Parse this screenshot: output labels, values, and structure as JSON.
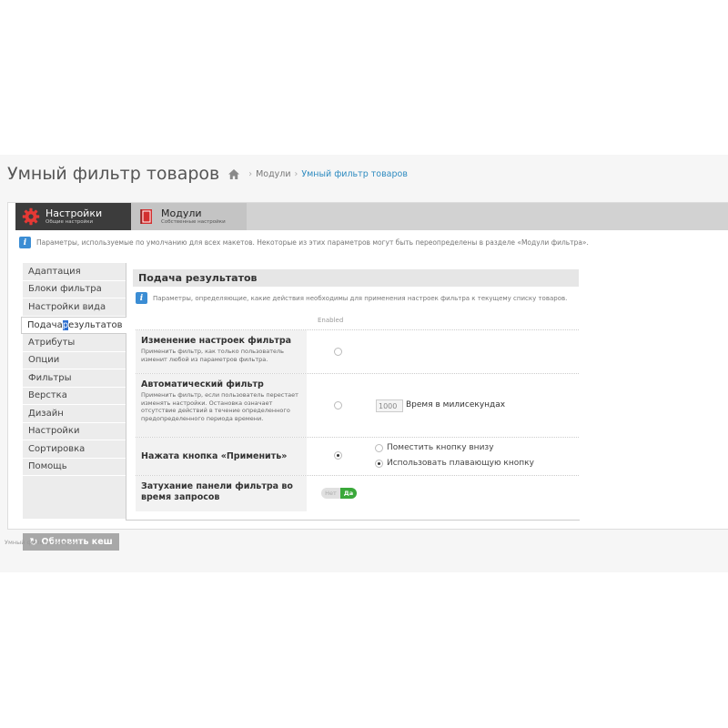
{
  "header": {
    "title": "Умный фильтр товаров",
    "breadcrumb": {
      "sep": "›",
      "modules": "Модули",
      "current": "Умный фильтр товаров"
    }
  },
  "tabs": [
    {
      "title": "Настройки",
      "subtitle": "Общие настройки",
      "icon": "gear-icon",
      "active": true
    },
    {
      "title": "Модули",
      "subtitle": "Собственные настройки",
      "icon": "book-icon",
      "active": false
    }
  ],
  "info": {
    "icon_letter": "i",
    "text": "Параметры, используемые по умолчанию для всех макетов. Некоторые из этих параметров могут быть переопределены в разделе «Модули фильтра»."
  },
  "sidebar": {
    "items": [
      "Адаптация",
      "Блоки фильтра",
      "Настройки вида",
      "Подача результатов",
      "Атрибуты",
      "Опции",
      "Фильтры",
      "Верстка",
      "Дизайн",
      "Настройки",
      "Сортировка",
      "Помощь"
    ],
    "active_index": 3,
    "active_parts": {
      "before": "Подача ",
      "highlight": "р",
      "after": "езультатов"
    },
    "refresh_button": {
      "icon": "↻",
      "label": "Обновить кеш"
    }
  },
  "content": {
    "section_title": "Подача результатов",
    "section_info": "Параметры, определяющие, какие действия необходимы для применения настроек фильтра к текущему списку товаров.",
    "column_header": "Enabled",
    "rows": {
      "change": {
        "title": "Изменение настроек фильтра",
        "desc": "Применить фильтр, как только пользователь изменит любой из параметров фильтра.",
        "checked": false
      },
      "auto": {
        "title": "Автоматический фильтр",
        "desc": "Применить фильтр, если пользователь перестает изменять настройки. Остановка означает отсутствие действий в течение определенного предопределенного периода времени.",
        "checked": false,
        "delay_value": "1000",
        "delay_label": "Время в милисекундах"
      },
      "apply": {
        "title": "Нажата кнопка «Применить»",
        "checked": true,
        "options": [
          {
            "label": "Поместить кнопку внизу",
            "checked": false
          },
          {
            "label": "Использовать плавающую кнопку",
            "checked": true
          }
        ]
      },
      "fade": {
        "title": "Затухание панели фильтра во время запросов",
        "toggle_off": "Нет",
        "toggle_on": "Да",
        "value": "Да"
      }
    }
  },
  "footer": {
    "text": "Умный фильтр товаров"
  },
  "colors": {
    "link": "#2e8bc0",
    "info": "#3b8dd4",
    "toggle_on": "#3aa83a",
    "tab_active": "#3c3c3c",
    "gear": "#e53935",
    "book": "#d32f2f"
  }
}
